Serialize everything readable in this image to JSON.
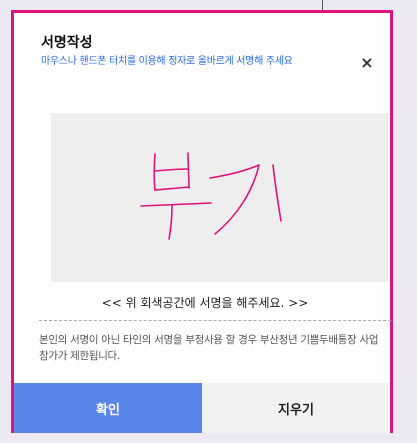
{
  "dialog": {
    "title": "서명작성",
    "subtitle": "마우스나 핸드폰 터치를 이용해 정자로 올바르게 서명해 주세요",
    "close_label": "×",
    "signature_text": "부기",
    "signature_color": "#e0127c",
    "pad_hint": "<< 위 회색공간에 서명을 해주세요. >>",
    "notice": "본인의 서명이 아닌 타인의 서명을 부정사용 할 경우 부산청년 기쁨두배통장 사업 참가가 제한됩니다.",
    "confirm_label": "확인",
    "clear_label": "지우기"
  },
  "colors": {
    "accent_border": "#e0127c",
    "link_blue": "#2b6cf0",
    "confirm_bg": "#5a86ea"
  }
}
